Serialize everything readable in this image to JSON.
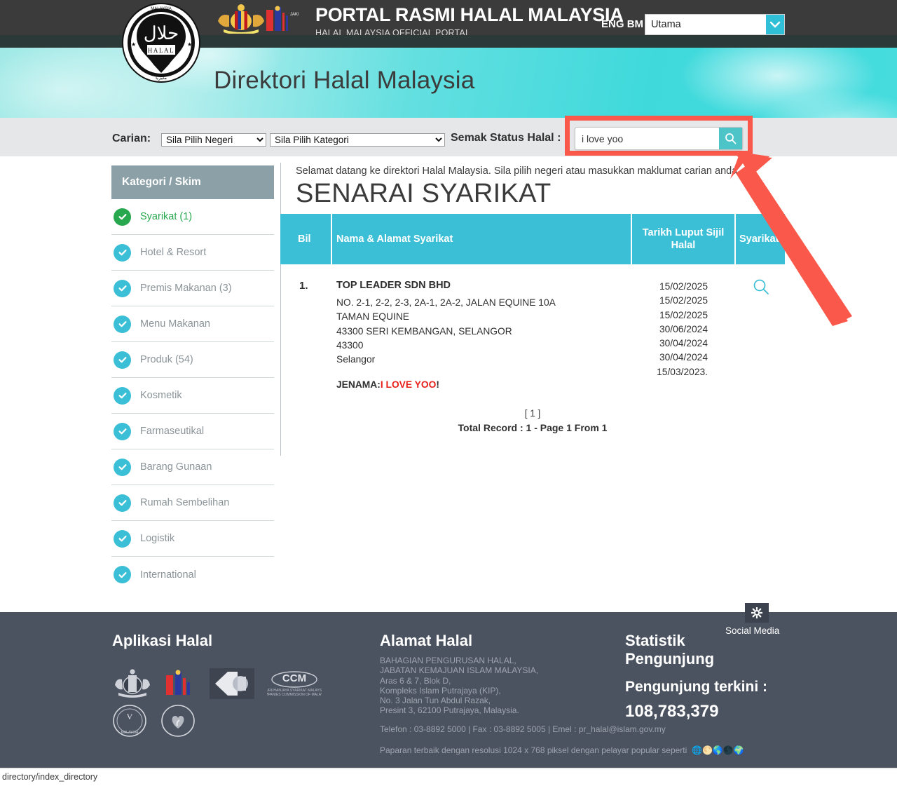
{
  "header": {
    "title": "PORTAL RASMI HALAL MALAYSIA",
    "subtitle": "HALAL MALAYSIA OFFICIAL PORTAL",
    "lang_eng": "ENG",
    "lang_bm": "BM",
    "nav_select_value": "Utama",
    "crest_icon": "malaysia-coat-of-arms-icon",
    "jakim_icon": "jakim-logo-icon",
    "halal_logo_icon": "halal-malaysia-logo-icon",
    "chevron_icon": "chevron-down-icon"
  },
  "hero": {
    "title": "Direktori Halal Malaysia"
  },
  "search": {
    "carian_label": "Carian:",
    "negeri_selected": "Sila Pilih Negeri",
    "negeri_options": [
      "Sila Pilih Negeri"
    ],
    "kategori_selected": "Sila Pilih Kategori",
    "kategori_options": [
      "Sila Pilih Kategori"
    ],
    "semak_label": "Semak Status Halal :",
    "query_value": "i love yoo",
    "query_placeholder": "",
    "search_icon": "search-icon",
    "highlight_color": "#f9584a"
  },
  "sidebar": {
    "heading": "Kategori / Skim",
    "items": [
      {
        "label": "Syarikat (1)",
        "active": true
      },
      {
        "label": "Hotel & Resort",
        "active": false
      },
      {
        "label": "Premis Makanan (3)",
        "active": false
      },
      {
        "label": "Menu Makanan",
        "active": false
      },
      {
        "label": "Produk (54)",
        "active": false
      },
      {
        "label": "Kosmetik",
        "active": false
      },
      {
        "label": "Farmaseutikal",
        "active": false
      },
      {
        "label": "Barang Gunaan",
        "active": false
      },
      {
        "label": "Rumah Sembelihan",
        "active": false
      },
      {
        "label": "Logistik",
        "active": false
      },
      {
        "label": "International",
        "active": false
      }
    ]
  },
  "main": {
    "welcome": "Selamat datang ke direktori Halal Malaysia. Sila pilih negeri atau masukkan maklumat carian anda.",
    "page_title": "SENARAI SYARIKAT",
    "columns": {
      "bil": "Bil",
      "nama": "Nama & Alamat Syarikat",
      "tarikh": "Tarikh Luput Sijil Halal",
      "syarikat": "Syarikat"
    },
    "row": {
      "number": "1.",
      "company": "TOP LEADER SDN BHD",
      "address": "NO. 2-1, 2-2, 2-3, 2A-1, 2A-2, JALAN EQUINE 10A\nTAMAN EQUINE\n43300 SERI KEMBANGAN, SELANGOR\n43300\nSelangor",
      "jenama_label": "JENAMA:",
      "jenama_brand": "I LOVE YOO",
      "jenama_suffix": "!",
      "dates": "15/02/2025\n15/02/2025\n15/02/2025\n30/06/2024\n30/04/2024\n30/04/2024\n15/03/2023.",
      "row_search_icon": "search-icon"
    },
    "pagination": "[ 1 ]",
    "total_record": "Total Record : 1 - Page 1 From 1"
  },
  "footer": {
    "aplikasi_heading": "Aplikasi Halal",
    "alamat_heading": "Alamat Halal",
    "statistik_heading": "Statistik Pengunjung",
    "address_lines": "BAHAGIAN PENGURUSAN HALAL,\nJABATAN KEMAJUAN ISLAM MALAYSIA,\nAras 6 & 7, Blok D,\nKompleks Islam Putrajaya (KIP),\nNo. 3 Jalan Tun Abdul Razak,\nPresint 3, 62100 Putrajaya, Malaysia.",
    "telephone": "Telefon : 03-8892 5000 | Fax : 03-8892 5005 | Emel : pr_halal@islam.gov.my",
    "resolution": "Paparan terbaik dengan resolusi 1024 x 768 piksel dengan pelayar popular seperti",
    "pengunjung_label": "Pengunjung terkini :",
    "pengunjung_count": "108,783,379",
    "social_media_label": "Social Media",
    "gear_icon": "gear-icon",
    "app_logos": [
      "malaysia-coat-of-arms-icon",
      "jakim-logo-icon",
      "mygov-logo-icon",
      "ssm-logo-icon",
      "veterinary-inspected-icon",
      "food-safety-icon"
    ],
    "browser_icons": [
      "chrome-icon",
      "firefox-icon",
      "edge-icon",
      "opera-icon",
      "safari-icon"
    ]
  },
  "statusbar": {
    "url": "directory/index_directory"
  }
}
